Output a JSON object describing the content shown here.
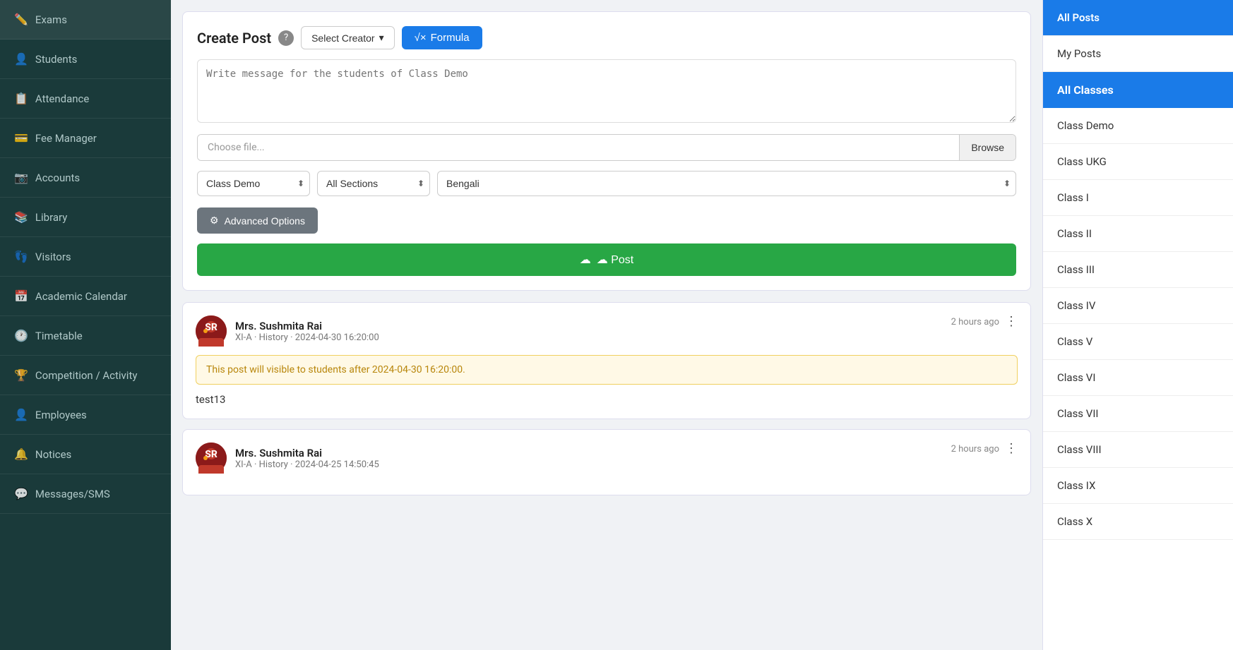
{
  "sidebar": {
    "items": [
      {
        "label": "Exams",
        "icon": "✏️"
      },
      {
        "label": "Students",
        "icon": "👤"
      },
      {
        "label": "Attendance",
        "icon": "📋"
      },
      {
        "label": "Fee Manager",
        "icon": "💳"
      },
      {
        "label": "Accounts",
        "icon": "📷"
      },
      {
        "label": "Library",
        "icon": "📚"
      },
      {
        "label": "Visitors",
        "icon": "👣"
      },
      {
        "label": "Academic Calendar",
        "icon": "📅"
      },
      {
        "label": "Timetable",
        "icon": "🕐"
      },
      {
        "label": "Competition / Activity",
        "icon": "🏆"
      },
      {
        "label": "Employees",
        "icon": "👤"
      },
      {
        "label": "Notices",
        "icon": "🔔"
      },
      {
        "label": "Messages/SMS",
        "icon": "💬"
      }
    ]
  },
  "create_post": {
    "title": "Create Post",
    "help_icon": "?",
    "select_creator_label": "Select Creator",
    "formula_button_label": "√✕ Formula",
    "formula_icon": "√×",
    "message_placeholder": "Write message for the students of Class Demo",
    "file_placeholder": "Choose file...",
    "browse_label": "Browse",
    "class_dropdown": "Class Demo",
    "section_dropdown": "All Sections",
    "language_dropdown": "Bengali",
    "advanced_options_label": "⚙ Advanced Options",
    "post_button_label": "☁ Post"
  },
  "posts": [
    {
      "author_name": "Mrs. Sushmita Rai",
      "author_meta": "XI-A · History · 2024-04-30 16:20:00",
      "time": "2 hours ago",
      "warning": "This post will visible to students after 2024-04-30 16:20:00.",
      "content": "test13"
    },
    {
      "author_name": "Mrs. Sushmita Rai",
      "author_meta": "XI-A · History · 2024-04-25 14:50:45",
      "time": "2 hours ago",
      "warning": "",
      "content": ""
    }
  ],
  "right_panel": {
    "all_posts_label": "All Posts",
    "my_posts_label": "My Posts",
    "all_classes_label": "All Classes",
    "classes": [
      "Class Demo",
      "Class UKG",
      "Class I",
      "Class II",
      "Class III",
      "Class IV",
      "Class V",
      "Class VI",
      "Class VII",
      "Class VIII",
      "Class IX",
      "Class X"
    ]
  }
}
